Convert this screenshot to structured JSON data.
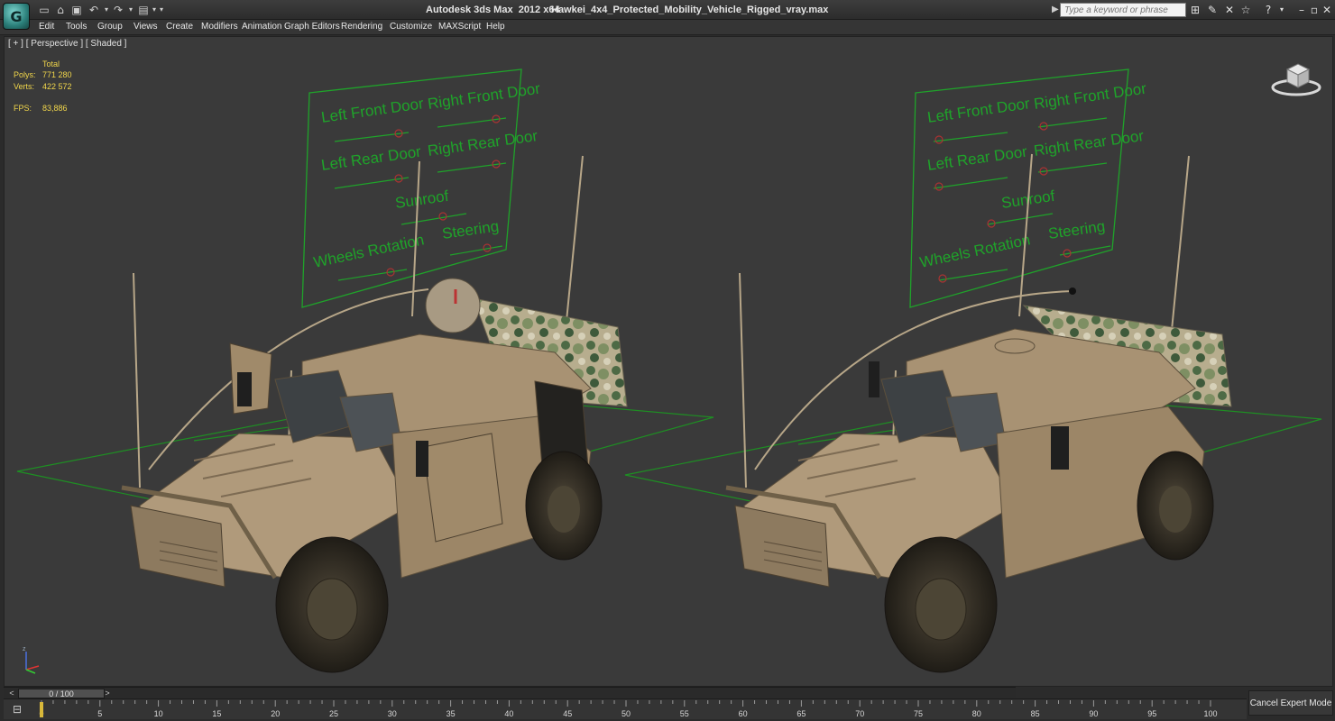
{
  "titlebar": {
    "app_title": "Autodesk 3ds Max  2012 x64",
    "file_name": "Hawkei_4x4_Protected_Mobility_Vehicle_Rigged_vray.max",
    "search_placeholder": "Type a keyword or phrase",
    "quick_access_icons": [
      "new-icon",
      "open-icon",
      "save-icon",
      "undo-icon",
      "redo-icon",
      "project-folder-icon"
    ]
  },
  "menu": {
    "items": [
      "Edit",
      "Tools",
      "Group",
      "Views",
      "Create",
      "Modifiers",
      "Animation",
      "Graph Editors",
      "Rendering",
      "Customize",
      "MAXScript",
      "Help"
    ]
  },
  "viewport": {
    "label": "[ + ] [ Perspective ] [ Shaded ]",
    "stats": {
      "header": "Total",
      "polys_label": "Polys:",
      "polys_value": "771 280",
      "verts_label": "Verts:",
      "verts_value": "422 572",
      "fps_label": "FPS:",
      "fps_value": "83,886"
    },
    "rig_panels": [
      {
        "controls": [
          "Left Front Door",
          "Right Front Door",
          "Left Rear Door",
          "Right Rear Door",
          "Sunroof",
          "Steering",
          "Wheels Rotation"
        ]
      },
      {
        "controls": [
          "Left Front Door",
          "Right Front Door",
          "Left Rear Door",
          "Right Rear Door",
          "Sunroof",
          "Steering",
          "Wheels Rotation"
        ]
      }
    ],
    "colors": {
      "background": "#3a3a3a",
      "rig_green": "#1fa32a",
      "grid_green": "#1e8f23",
      "vehicle_tan": "#a89273",
      "stats_yellow": "#f2d74b"
    }
  },
  "timeline": {
    "slider_text": "0 / 100",
    "current_frame": 0,
    "total_frames": 100,
    "ticks": [
      "0",
      "5",
      "10",
      "15",
      "20",
      "25",
      "30",
      "35",
      "40",
      "45",
      "50",
      "55",
      "60",
      "65",
      "70",
      "75",
      "80",
      "85",
      "90",
      "95",
      "100"
    ],
    "cancel_expert_label": "Cancel Expert Mode"
  }
}
